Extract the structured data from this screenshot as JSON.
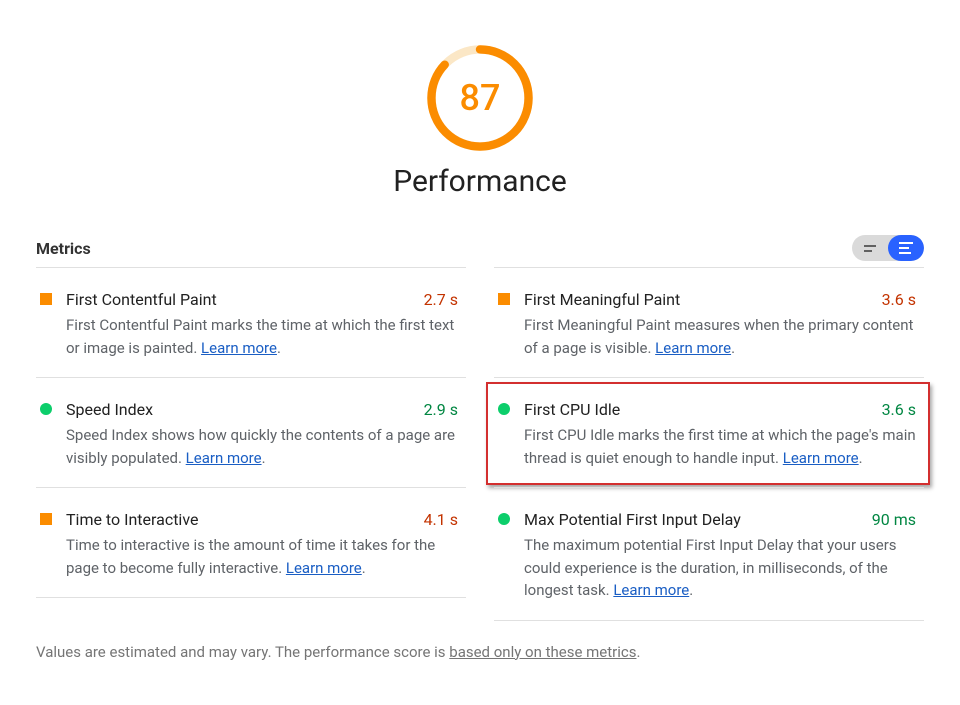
{
  "score": "87",
  "category_title": "Performance",
  "metrics_label": "Metrics",
  "learn_more_label": "Learn more",
  "left": [
    {
      "title": "First Contentful Paint",
      "value": "2.7 s",
      "desc_pre": "First Contentful Paint marks the time at which the first text or image is painted. ",
      "desc_post": "."
    },
    {
      "title": "Speed Index",
      "value": "2.9 s",
      "desc_pre": "Speed Index shows how quickly the contents of a page are visibly populated. ",
      "desc_post": "."
    },
    {
      "title": "Time to Interactive",
      "value": "4.1 s",
      "desc_pre": "Time to interactive is the amount of time it takes for the page to become fully interactive. ",
      "desc_post": "."
    }
  ],
  "right": [
    {
      "title": "First Meaningful Paint",
      "value": "3.6 s",
      "desc_pre": "First Meaningful Paint measures when the primary content of a page is visible. ",
      "desc_post": "."
    },
    {
      "title": "First CPU Idle",
      "value": "3.6 s",
      "desc_pre": "First CPU Idle marks the first time at which the page's main thread is quiet enough to handle input. ",
      "desc_post": "."
    },
    {
      "title": "Max Potential First Input Delay",
      "value": "90 ms",
      "desc_pre": "The maximum potential First Input Delay that your users could experience is the duration, in milliseconds, of the longest task. ",
      "desc_post": "."
    }
  ],
  "footnote_pre": "Values are estimated and may vary. The performance score is ",
  "footnote_link": "based only on these metrics",
  "footnote_post": "."
}
